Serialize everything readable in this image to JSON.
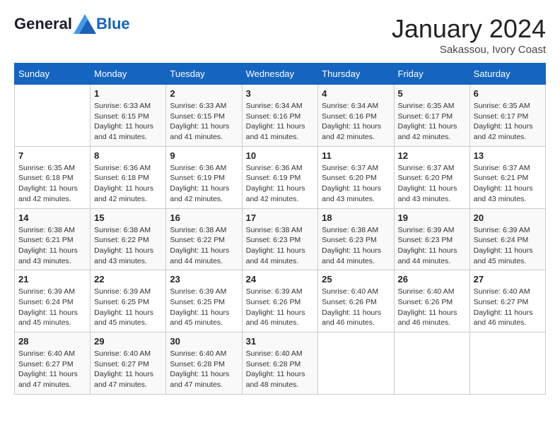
{
  "header": {
    "logo_general": "General",
    "logo_blue": "Blue",
    "month": "January 2024",
    "location": "Sakassou, Ivory Coast"
  },
  "weekdays": [
    "Sunday",
    "Monday",
    "Tuesday",
    "Wednesday",
    "Thursday",
    "Friday",
    "Saturday"
  ],
  "weeks": [
    [
      {
        "day": "",
        "info": ""
      },
      {
        "day": "1",
        "info": "Sunrise: 6:33 AM\nSunset: 6:15 PM\nDaylight: 11 hours\nand 41 minutes."
      },
      {
        "day": "2",
        "info": "Sunrise: 6:33 AM\nSunset: 6:15 PM\nDaylight: 11 hours\nand 41 minutes."
      },
      {
        "day": "3",
        "info": "Sunrise: 6:34 AM\nSunset: 6:16 PM\nDaylight: 11 hours\nand 41 minutes."
      },
      {
        "day": "4",
        "info": "Sunrise: 6:34 AM\nSunset: 6:16 PM\nDaylight: 11 hours\nand 42 minutes."
      },
      {
        "day": "5",
        "info": "Sunrise: 6:35 AM\nSunset: 6:17 PM\nDaylight: 11 hours\nand 42 minutes."
      },
      {
        "day": "6",
        "info": "Sunrise: 6:35 AM\nSunset: 6:17 PM\nDaylight: 11 hours\nand 42 minutes."
      }
    ],
    [
      {
        "day": "7",
        "info": "Sunrise: 6:35 AM\nSunset: 6:18 PM\nDaylight: 11 hours\nand 42 minutes."
      },
      {
        "day": "8",
        "info": "Sunrise: 6:36 AM\nSunset: 6:18 PM\nDaylight: 11 hours\nand 42 minutes."
      },
      {
        "day": "9",
        "info": "Sunrise: 6:36 AM\nSunset: 6:19 PM\nDaylight: 11 hours\nand 42 minutes."
      },
      {
        "day": "10",
        "info": "Sunrise: 6:36 AM\nSunset: 6:19 PM\nDaylight: 11 hours\nand 42 minutes."
      },
      {
        "day": "11",
        "info": "Sunrise: 6:37 AM\nSunset: 6:20 PM\nDaylight: 11 hours\nand 43 minutes."
      },
      {
        "day": "12",
        "info": "Sunrise: 6:37 AM\nSunset: 6:20 PM\nDaylight: 11 hours\nand 43 minutes."
      },
      {
        "day": "13",
        "info": "Sunrise: 6:37 AM\nSunset: 6:21 PM\nDaylight: 11 hours\nand 43 minutes."
      }
    ],
    [
      {
        "day": "14",
        "info": "Sunrise: 6:38 AM\nSunset: 6:21 PM\nDaylight: 11 hours\nand 43 minutes."
      },
      {
        "day": "15",
        "info": "Sunrise: 6:38 AM\nSunset: 6:22 PM\nDaylight: 11 hours\nand 43 minutes."
      },
      {
        "day": "16",
        "info": "Sunrise: 6:38 AM\nSunset: 6:22 PM\nDaylight: 11 hours\nand 44 minutes."
      },
      {
        "day": "17",
        "info": "Sunrise: 6:38 AM\nSunset: 6:23 PM\nDaylight: 11 hours\nand 44 minutes."
      },
      {
        "day": "18",
        "info": "Sunrise: 6:38 AM\nSunset: 6:23 PM\nDaylight: 11 hours\nand 44 minutes."
      },
      {
        "day": "19",
        "info": "Sunrise: 6:39 AM\nSunset: 6:23 PM\nDaylight: 11 hours\nand 44 minutes."
      },
      {
        "day": "20",
        "info": "Sunrise: 6:39 AM\nSunset: 6:24 PM\nDaylight: 11 hours\nand 45 minutes."
      }
    ],
    [
      {
        "day": "21",
        "info": "Sunrise: 6:39 AM\nSunset: 6:24 PM\nDaylight: 11 hours\nand 45 minutes."
      },
      {
        "day": "22",
        "info": "Sunrise: 6:39 AM\nSunset: 6:25 PM\nDaylight: 11 hours\nand 45 minutes."
      },
      {
        "day": "23",
        "info": "Sunrise: 6:39 AM\nSunset: 6:25 PM\nDaylight: 11 hours\nand 45 minutes."
      },
      {
        "day": "24",
        "info": "Sunrise: 6:39 AM\nSunset: 6:26 PM\nDaylight: 11 hours\nand 46 minutes."
      },
      {
        "day": "25",
        "info": "Sunrise: 6:40 AM\nSunset: 6:26 PM\nDaylight: 11 hours\nand 46 minutes."
      },
      {
        "day": "26",
        "info": "Sunrise: 6:40 AM\nSunset: 6:26 PM\nDaylight: 11 hours\nand 46 minutes."
      },
      {
        "day": "27",
        "info": "Sunrise: 6:40 AM\nSunset: 6:27 PM\nDaylight: 11 hours\nand 46 minutes."
      }
    ],
    [
      {
        "day": "28",
        "info": "Sunrise: 6:40 AM\nSunset: 6:27 PM\nDaylight: 11 hours\nand 47 minutes."
      },
      {
        "day": "29",
        "info": "Sunrise: 6:40 AM\nSunset: 6:27 PM\nDaylight: 11 hours\nand 47 minutes."
      },
      {
        "day": "30",
        "info": "Sunrise: 6:40 AM\nSunset: 6:28 PM\nDaylight: 11 hours\nand 47 minutes."
      },
      {
        "day": "31",
        "info": "Sunrise: 6:40 AM\nSunset: 6:28 PM\nDaylight: 11 hours\nand 48 minutes."
      },
      {
        "day": "",
        "info": ""
      },
      {
        "day": "",
        "info": ""
      },
      {
        "day": "",
        "info": ""
      }
    ]
  ]
}
